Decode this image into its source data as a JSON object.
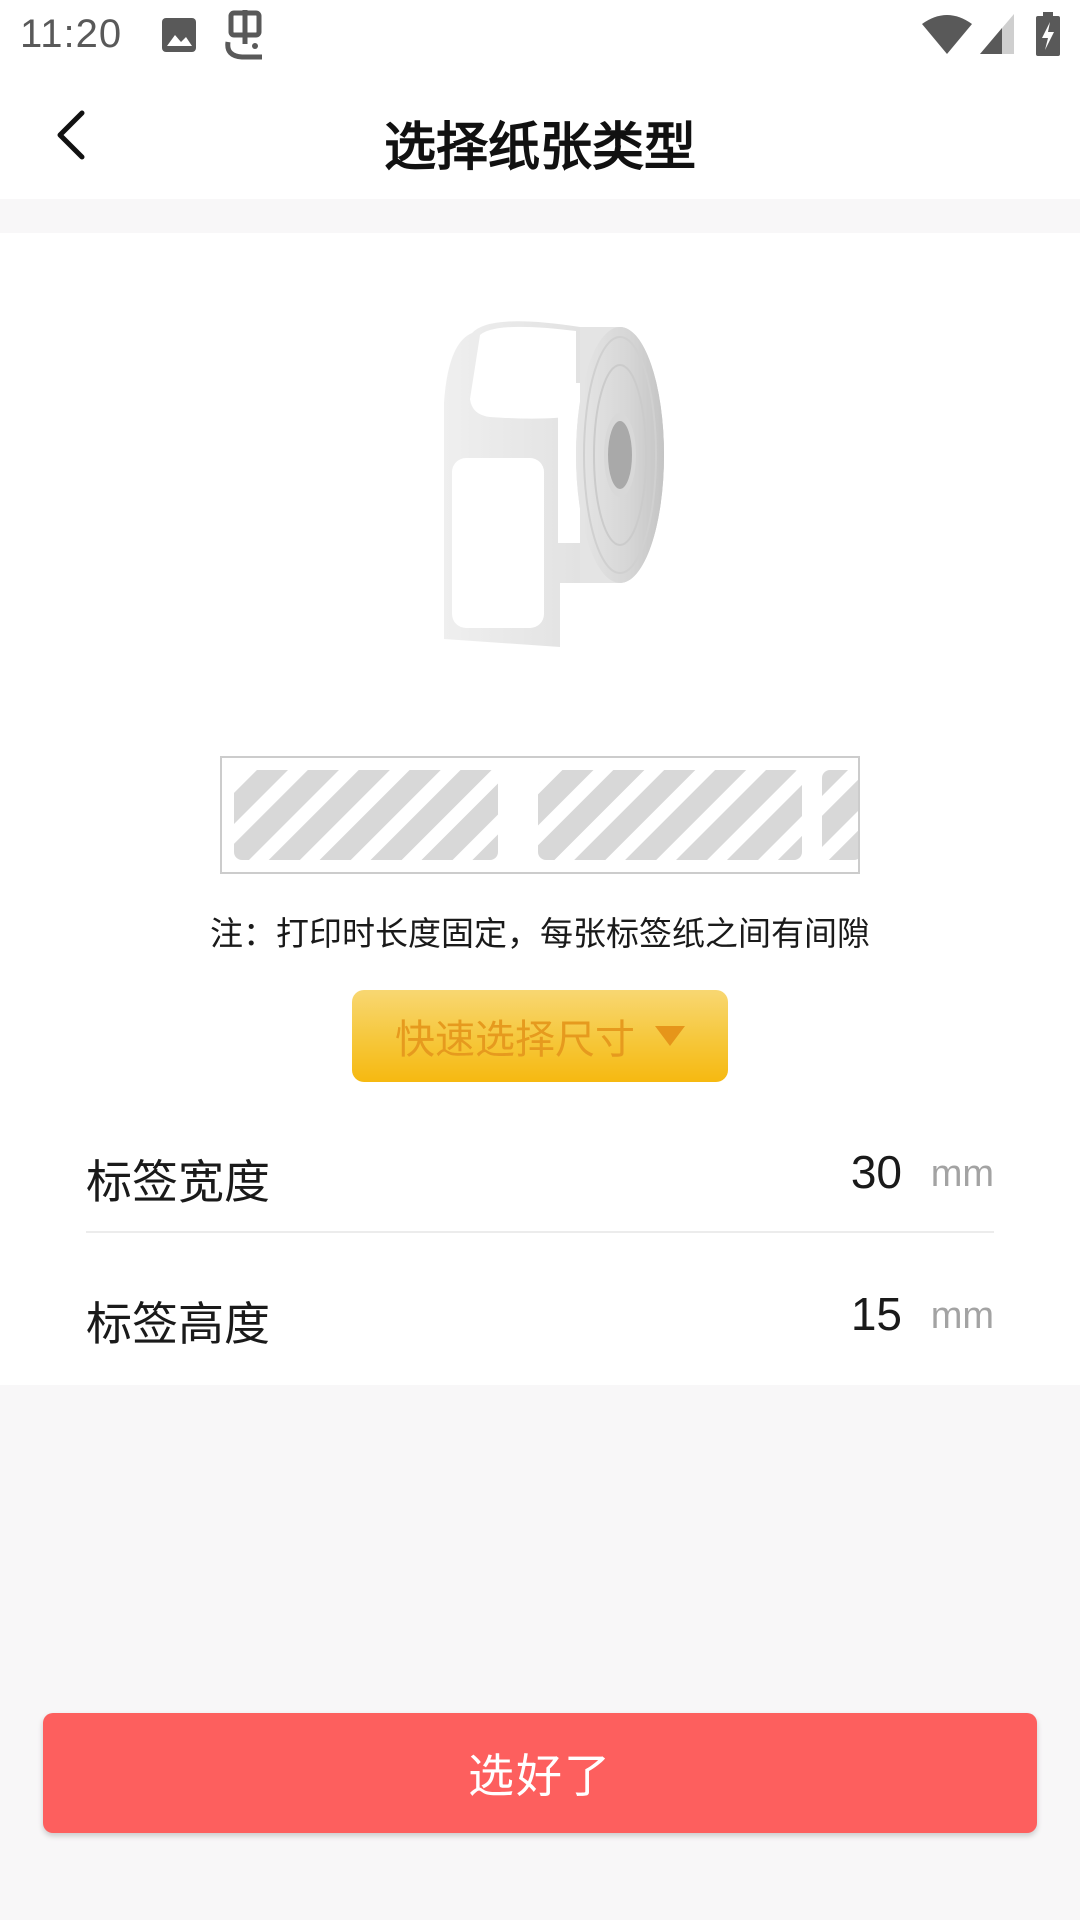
{
  "status_bar": {
    "time": "11:20",
    "icons": [
      "image-icon",
      "bug-icon",
      "wifi-icon",
      "cell-signal-icon",
      "battery-charging-icon"
    ]
  },
  "header": {
    "back_icon": "chevron-left-icon",
    "title": "选择纸张类型"
  },
  "main": {
    "illustration": "label-roll",
    "diagram": "gap-label-strip",
    "note": "注：打印时长度固定，每张标签纸之间有间隙",
    "quick_size_button": {
      "label": "快速选择尺寸",
      "icon": "triangle-down-icon"
    },
    "fields": [
      {
        "label": "标签宽度",
        "value": "30",
        "unit": "mm"
      },
      {
        "label": "标签高度",
        "value": "15",
        "unit": "mm"
      }
    ]
  },
  "confirm_button": {
    "label": "选好了"
  },
  "colors": {
    "accent_red": "#fd5f5e",
    "button_yellow": "#f6c73a",
    "button_text_orange": "#e69a1e",
    "background": "#f8f7f8"
  }
}
